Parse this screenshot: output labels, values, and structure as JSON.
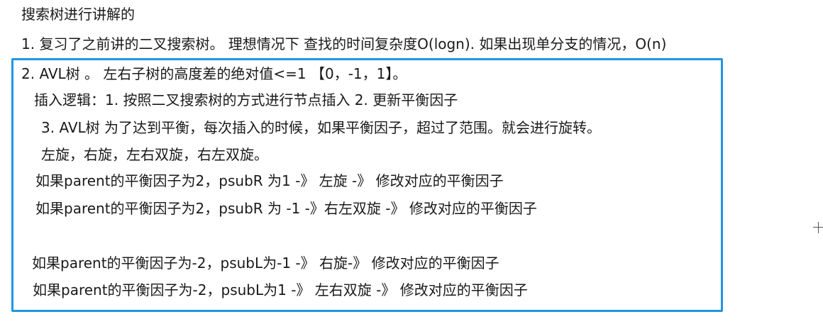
{
  "title": "搜索树进行讲解的",
  "line1": "1. 复习了之前讲的二叉搜索树。 理想情况下  查找的时间复杂度O(logn).  如果出现单分支的情况，O(n)",
  "box": {
    "line2": "2. AVL树 。 左右子树的高度差的绝对值<=1 【0，-1，1】。",
    "line3": "插入逻辑：1. 按照二叉搜索树的方式进行节点插入   2.  更新平衡因子",
    "line4": "3. AVL树  为了达到平衡，每次插入的时候，如果平衡因子，超过了范围。就会进行旋转。",
    "line5": "左旋，右旋，左右双旋，右左双旋。",
    "line6": "如果parent的平衡因子为2，psubR 为1 -》 左旋 -》 修改对应的平衡因子",
    "line7": "如果parent的平衡因子为2，psubR 为 -1 -》右左双旋 -》 修改对应的平衡因子",
    "line8": "如果parent的平衡因子为-2，psubL为-1 -》 右旋-》 修改对应的平衡因子",
    "line9": "如果parent的平衡因子为-2，psubL为1 -》  左右双旋 -》 修改对应的平衡因子"
  },
  "colors": {
    "box_border": "#2196e0",
    "text": "#1a1a1a"
  }
}
